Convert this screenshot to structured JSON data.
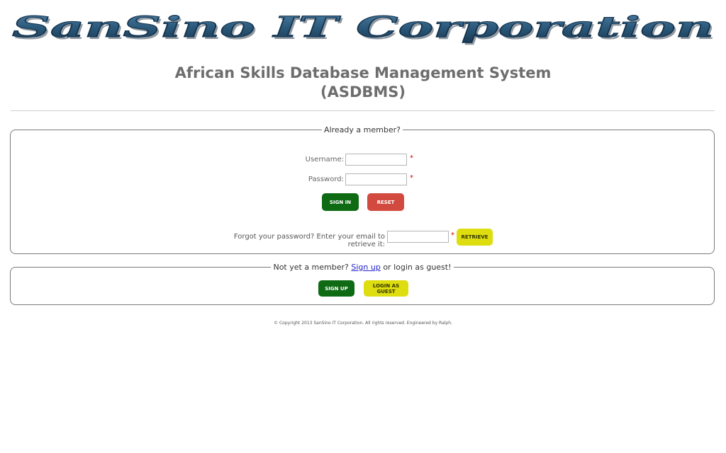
{
  "banner": {
    "text": "SanSino   IT   Corporation"
  },
  "header": {
    "title_line1": "African Skills Database Management System",
    "title_line2": "(ASDBMS)"
  },
  "login": {
    "legend": "Already a member?",
    "username_label": "Username:",
    "password_label": "Password:",
    "required_mark": "*",
    "signin_label": "SIGN IN",
    "reset_label": "RESET",
    "forgot_text": "Forgot your password? Enter your email to retrieve it:",
    "retrieve_label": "RETRIEVE"
  },
  "guest": {
    "legend_prefix": "Not yet a member?",
    "legend_link": "Sign up",
    "legend_suffix": "or login as guest!",
    "signup_label": "SIGN UP",
    "guest_label": "LOGIN AS GUEST"
  },
  "footer": {
    "text": "© Copyright 2013 SanSino IT Corporation. All rights reserved. Engineered by Ralph."
  },
  "colors": {
    "banner_blue": "#2c5a7c",
    "green": "#0f6a14",
    "red": "#d24a3f",
    "yellow": "#dddd10"
  }
}
